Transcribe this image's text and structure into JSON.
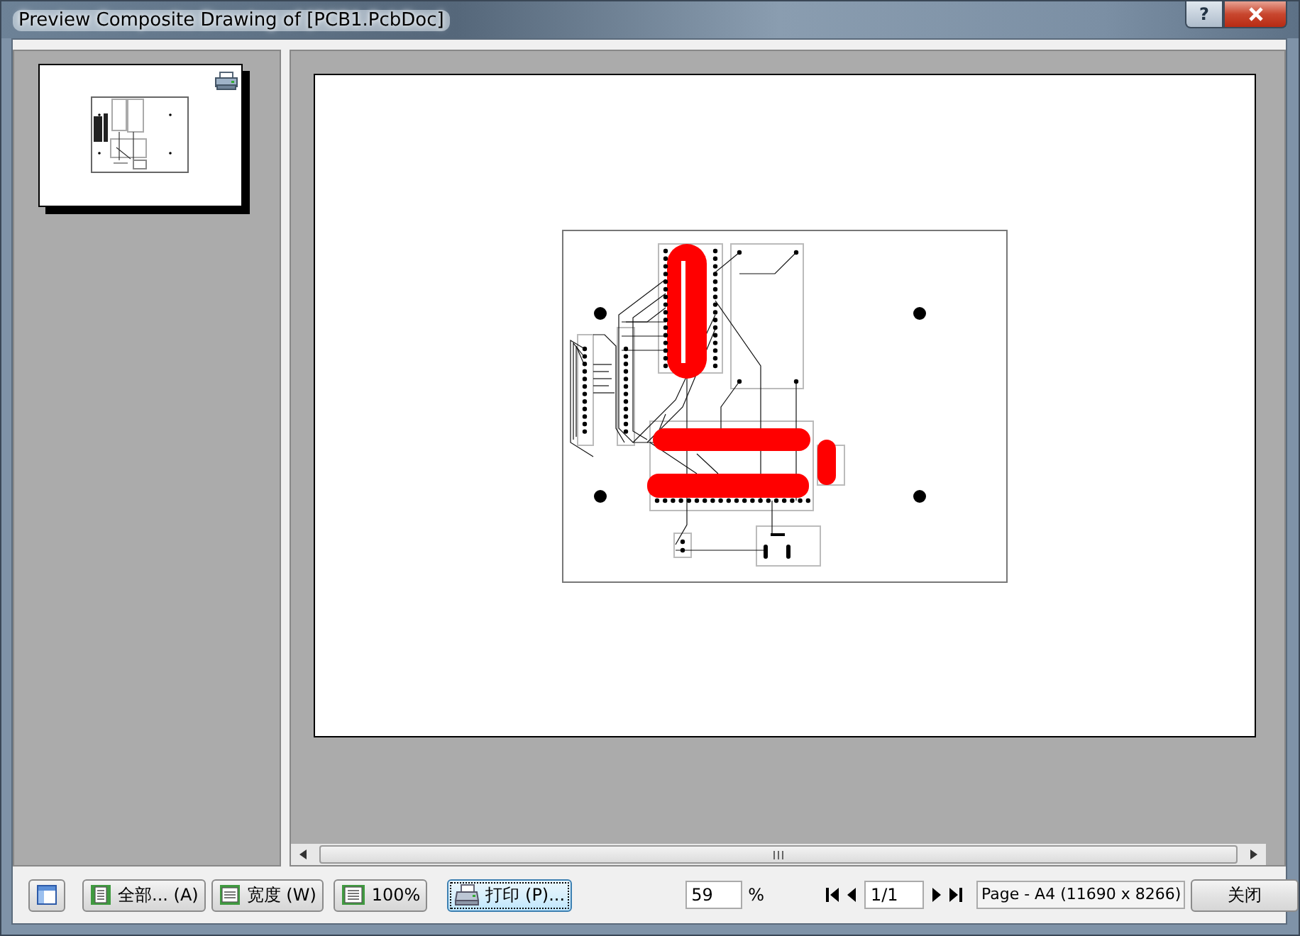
{
  "window": {
    "title": "Preview Composite Drawing of [PCB1.PcbDoc]",
    "help": "?"
  },
  "toolbar": {
    "buttons": [
      {
        "kind": "fit-all",
        "label": "全部... (A)",
        "focused": false
      },
      {
        "kind": "fit-width",
        "label": "宽度 (W)",
        "focused": false
      },
      {
        "kind": "actual-size",
        "label": "100%",
        "focused": false
      },
      {
        "kind": "print",
        "label": "打印 (P)...",
        "focused": true
      }
    ],
    "zoom": {
      "value": "59",
      "unit": "%"
    },
    "page": {
      "value": "1/1"
    },
    "status": "Page - A4 (11690 x 8266)",
    "close_button": "关闭"
  }
}
